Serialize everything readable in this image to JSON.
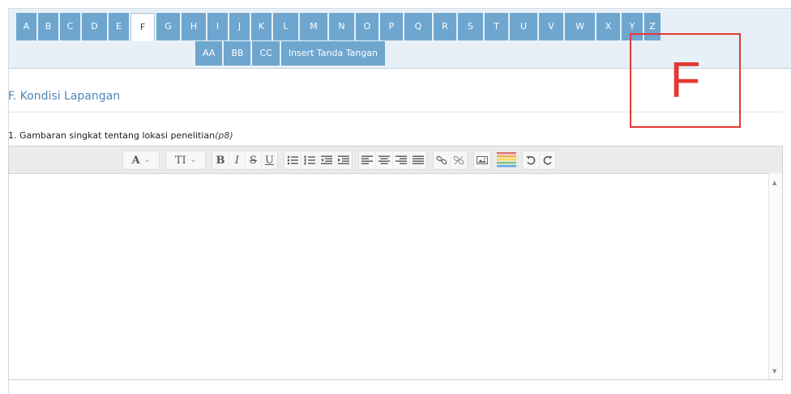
{
  "tabs": {
    "row1": [
      {
        "label": "A",
        "w": 25
      },
      {
        "label": "B",
        "w": 25
      },
      {
        "label": "C",
        "w": 25
      },
      {
        "label": "D",
        "w": 31
      },
      {
        "label": "E",
        "w": 25
      },
      {
        "label": "F",
        "w": 30,
        "active": true
      },
      {
        "label": "G",
        "w": 29
      },
      {
        "label": "H",
        "w": 30
      },
      {
        "label": "I",
        "w": 25
      },
      {
        "label": "J",
        "w": 25
      },
      {
        "label": "K",
        "w": 25
      },
      {
        "label": "L",
        "w": 31
      },
      {
        "label": "M",
        "w": 34
      },
      {
        "label": "N",
        "w": 31
      },
      {
        "label": "O",
        "w": 28
      },
      {
        "label": "P",
        "w": 28
      },
      {
        "label": "Q",
        "w": 34
      },
      {
        "label": "R",
        "w": 28
      },
      {
        "label": "S",
        "w": 31
      },
      {
        "label": "T",
        "w": 29
      },
      {
        "label": "U",
        "w": 34
      },
      {
        "label": "V",
        "w": 30
      },
      {
        "label": "W",
        "w": 37
      },
      {
        "label": "X",
        "w": 29
      },
      {
        "label": "Y",
        "w": 26
      },
      {
        "label": "Z",
        "w": 20
      }
    ],
    "row2": [
      "AA",
      "BB",
      "CC",
      "Insert Tanda Tangan"
    ]
  },
  "section": {
    "title": "F. Kondisi Lapangan",
    "question": "1. Gambaran singkat tentang lokasi penelitian",
    "question_ref": "(p8)"
  },
  "toolbar": {
    "font_label": "A",
    "size_label": "TI",
    "bold": "B",
    "italic": "I",
    "strike": "S",
    "underline": "U"
  },
  "stamp_letter": "F",
  "colors": {
    "tab": "#6ea6cf",
    "stamp": "#e53935",
    "title": "#4f86b8"
  }
}
